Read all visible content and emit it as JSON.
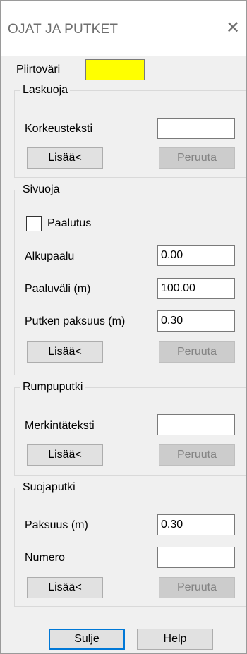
{
  "window": {
    "title": "OJAT JA PUTKET",
    "close_glyph": "✕"
  },
  "piirtovari": {
    "label": "Piirtoväri",
    "color": "#ffff00"
  },
  "laskuoja": {
    "legend": "Laskuoja",
    "field_label": "Korkeusteksti",
    "field_value": "",
    "add_label": "Lisää<",
    "cancel_label": "Peruuta"
  },
  "sivuoja": {
    "legend": "Sivuoja",
    "checkbox_label": "Paalutus",
    "checkbox_checked": false,
    "alkupaalu_label": "Alkupaalu",
    "alkupaalu_value": "0.00",
    "paaluvali_label": "Paaluväli (m)",
    "paaluvali_value": "100.00",
    "putken_label": "Putken paksuus (m)",
    "putken_value": "0.30",
    "add_label": "Lisää<",
    "cancel_label": "Peruuta"
  },
  "rumpuputki": {
    "legend": "Rumpuputki",
    "field_label": "Merkintäteksti",
    "field_value": "",
    "add_label": "Lisää<",
    "cancel_label": "Peruuta"
  },
  "suojaputki": {
    "legend": "Suojaputki",
    "paksuus_label": "Paksuus (m)",
    "paksuus_value": "0.30",
    "numero_label": "Numero",
    "numero_value": "",
    "add_label": "Lisää<",
    "cancel_label": "Peruuta"
  },
  "footer": {
    "close_label": "Sulje",
    "help_label": "Help"
  }
}
